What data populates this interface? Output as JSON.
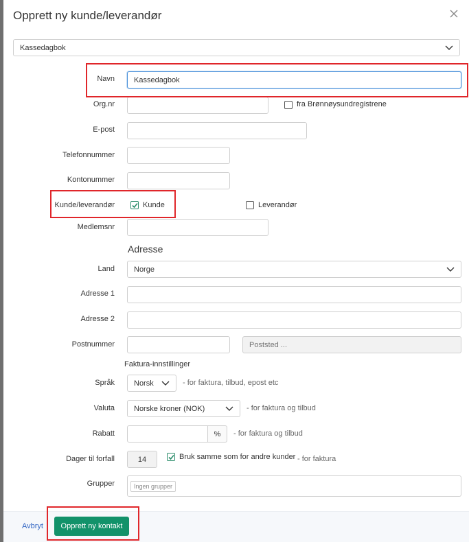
{
  "dialog": {
    "title": "Opprett ny kunde/leverandør",
    "template_select": "Kassedagbok"
  },
  "form": {
    "navn_label": "Navn",
    "navn_value": "Kassedagbok",
    "orgnr_label": "Org.nr",
    "orgnr_value": "",
    "bronnoysund_label": "fra Brønnøysundregistrene",
    "epost_label": "E-post",
    "telefon_label": "Telefonnummer",
    "konto_label": "Kontonummer",
    "kundelev_label": "Kunde/leverandør",
    "kunde_label": "Kunde",
    "kunde_checked": true,
    "leverandor_label": "Leverandør",
    "leverandor_checked": false,
    "medlemsnr_label": "Medlemsnr"
  },
  "address": {
    "heading": "Adresse",
    "land_label": "Land",
    "land_value": "Norge",
    "adresse1_label": "Adresse 1",
    "adresse2_label": "Adresse 2",
    "postnummer_label": "Postnummer",
    "poststed_placeholder": "Poststed ..."
  },
  "invoice": {
    "heading": "Faktura-innstillinger",
    "sprak_label": "Språk",
    "sprak_value": "Norsk",
    "sprak_hint": "- for faktura, tilbud, epost etc",
    "valuta_label": "Valuta",
    "valuta_value": "Norske kroner (NOK)",
    "valuta_hint": "- for faktura og tilbud",
    "rabatt_label": "Rabatt",
    "rabatt_unit": "%",
    "rabatt_hint": "- for faktura og tilbud",
    "dager_label": "Dager til forfall",
    "dager_value": "14",
    "bruk_samme_label": "Bruk samme som for andre kunder",
    "bruk_samme_checked": true,
    "dager_hint": "- for faktura",
    "grupper_label": "Grupper",
    "grupper_tag": "Ingen grupper"
  },
  "footer": {
    "cancel_label": "Avbryt",
    "submit_label": "Opprett ny kontakt"
  },
  "colors": {
    "primary": "#12926a",
    "highlight": "#e0262a",
    "link": "#3467c4",
    "focus": "#4a90d9"
  }
}
